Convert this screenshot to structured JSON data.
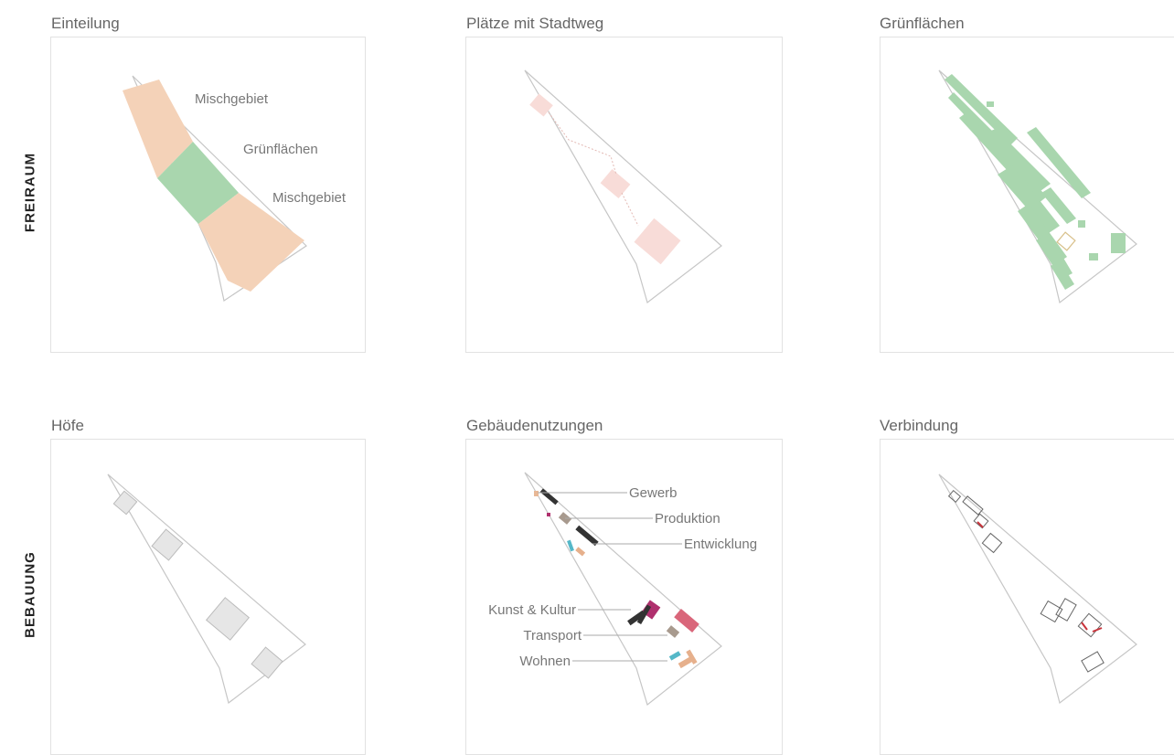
{
  "rows": {
    "freiraum": "FREIRAUM",
    "bebauung": "BEBAUUNG"
  },
  "panels": {
    "einteilung": {
      "title": "Einteilung",
      "labels": [
        "Mischgebiet",
        "Grünflächen",
        "Mischgebiet"
      ]
    },
    "plaetze": {
      "title": "Plätze mit Stadtweg"
    },
    "gruenflaechen": {
      "title": "Grünflächen"
    },
    "hoefe": {
      "title": "Höfe"
    },
    "gebaeude": {
      "title": "Gebäudenutzungen",
      "labels": [
        "Gewerb",
        "Produktion",
        "Entwicklung",
        "Kunst & Kultur",
        "Transport",
        "Wohnen"
      ]
    },
    "verbindung": {
      "title": "Verbindung"
    }
  },
  "colors": {
    "mischgebiet": "#f4d2b8",
    "gruen": "#a9d6ae",
    "platz": "#f8dcd8",
    "hof": "#e6e6e6",
    "gewerb": "#e8b896",
    "produktion": "#a89a8e",
    "entwicklung": "#333333",
    "kultur": "#b0306e",
    "transport": "#555555",
    "wohnen": "#e6b08c",
    "teal": "#55b8c8",
    "rose": "#d9667a",
    "link": "#c8343c",
    "outline": "#bdbdbd"
  }
}
